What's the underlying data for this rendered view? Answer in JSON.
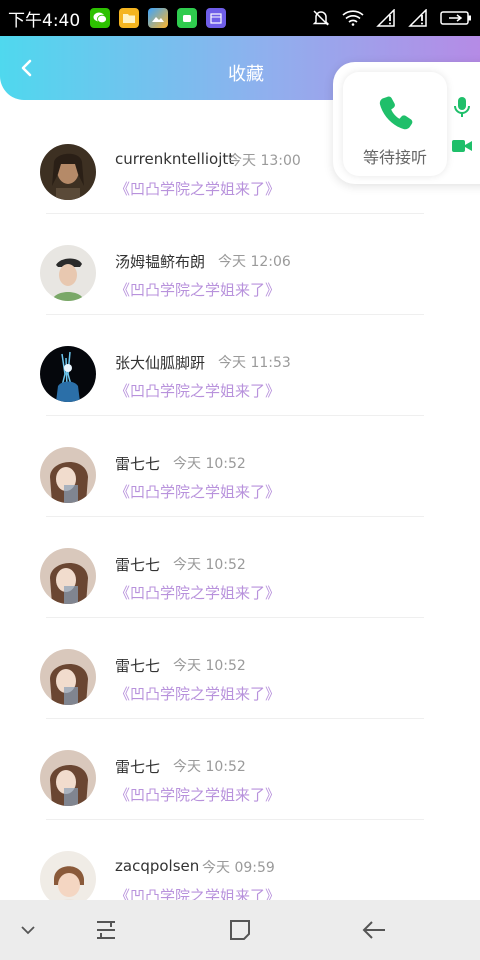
{
  "status_bar": {
    "time": "下午4:40",
    "apps": [
      "wechat-icon",
      "folder-icon",
      "gallery-icon",
      "android-market-icon",
      "calendar-icon"
    ],
    "indicators": [
      "mute-bell-icon",
      "wifi-icon",
      "signal-1-icon",
      "signal-2-icon",
      "battery-icon"
    ]
  },
  "header": {
    "title": "收藏",
    "gradient": [
      "#4fd8ee",
      "#b58be6"
    ]
  },
  "call": {
    "label": "等待接听",
    "accent": "#1fbf6a"
  },
  "items": [
    {
      "name": "currenkntelliojtt",
      "time": "今天 13:00",
      "subtitle": "《凹凸学院之学姐来了》",
      "avatar": "avatar-man-long-hair"
    },
    {
      "name": "汤姆韫鲚布朗",
      "time": "今天 12:06",
      "subtitle": "《凹凸学院之学姐来了》",
      "avatar": "avatar-boy-cap"
    },
    {
      "name": "张大仙胍脚趼",
      "time": "今天 11:53",
      "subtitle": "《凹凸学院之学姐来了》",
      "avatar": "avatar-dark-art"
    },
    {
      "name": "雷七七",
      "time": "今天 10:52",
      "subtitle": "《凹凸学院之学姐来了》",
      "avatar": "avatar-girl"
    },
    {
      "name": "雷七七",
      "time": "今天 10:52",
      "subtitle": "《凹凸学院之学姐来了》",
      "avatar": "avatar-girl"
    },
    {
      "name": "雷七七",
      "time": "今天 10:52",
      "subtitle": "《凹凸学院之学姐来了》",
      "avatar": "avatar-girl"
    },
    {
      "name": "雷七七",
      "time": "今天 10:52",
      "subtitle": "《凹凸学院之学姐来了》",
      "avatar": "avatar-girl"
    },
    {
      "name": "zacqpolsen",
      "time": "今天 09:59",
      "subtitle": "《凹凸学院之学姐来了》",
      "avatar": "avatar-child"
    }
  ],
  "nav": [
    "chevron-down-icon",
    "recent-apps-icon",
    "home-icon",
    "back-arrow-icon"
  ]
}
